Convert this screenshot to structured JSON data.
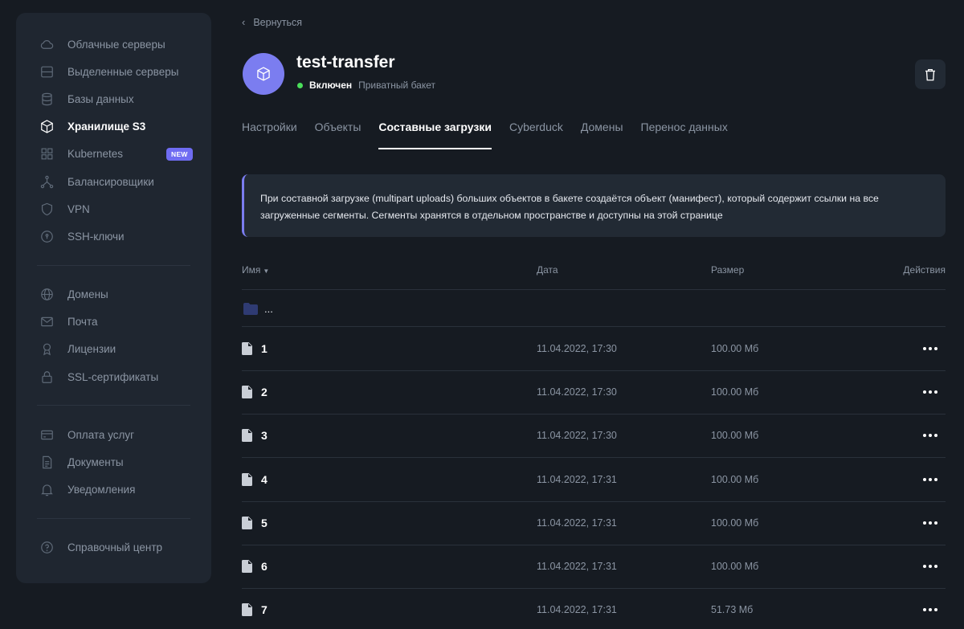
{
  "sidebar": {
    "group1": [
      {
        "label": "Облачные серверы",
        "icon": "cloud-icon"
      },
      {
        "label": "Выделенные серверы",
        "icon": "server-icon"
      },
      {
        "label": "Базы данных",
        "icon": "database-icon"
      },
      {
        "label": "Хранилище S3",
        "icon": "cube-icon",
        "active": true
      },
      {
        "label": "Kubernetes",
        "icon": "grid-icon",
        "badge": "NEW"
      },
      {
        "label": "Балансировщики",
        "icon": "balancer-icon"
      },
      {
        "label": "VPN",
        "icon": "shield-icon"
      },
      {
        "label": "SSH-ключи",
        "icon": "key-icon"
      }
    ],
    "group2": [
      {
        "label": "Домены",
        "icon": "globe-icon"
      },
      {
        "label": "Почта",
        "icon": "mail-icon"
      },
      {
        "label": "Лицензии",
        "icon": "license-icon"
      },
      {
        "label": "SSL-сертификаты",
        "icon": "lock-icon"
      }
    ],
    "group3": [
      {
        "label": "Оплата услуг",
        "icon": "card-icon"
      },
      {
        "label": "Документы",
        "icon": "document-icon"
      },
      {
        "label": "Уведомления",
        "icon": "bell-icon"
      }
    ],
    "group4": [
      {
        "label": "Справочный центр",
        "icon": "help-icon"
      }
    ]
  },
  "header": {
    "back_label": "Вернуться",
    "title": "test-transfer",
    "status": "Включен",
    "bucket_type": "Приватный бакет"
  },
  "tabs": [
    {
      "label": "Настройки"
    },
    {
      "label": "Объекты"
    },
    {
      "label": "Составные загрузки",
      "active": true
    },
    {
      "label": "Cyberduck"
    },
    {
      "label": "Домены"
    },
    {
      "label": "Перенос данных"
    }
  ],
  "info_text": "При составной загрузке (multipart uploads) больших объектов в бакете создаётся объект (манифест), который содержит ссылки на все загруженные сегменты. Сегменты хранятся в отдельном пространстве и доступны на этой странице",
  "table": {
    "headers": {
      "name": "Имя",
      "date": "Дата",
      "size": "Размер",
      "actions": "Действия"
    },
    "parent_folder": "...",
    "rows": [
      {
        "name": "1",
        "date": "11.04.2022, 17:30",
        "size": "100.00 Мб"
      },
      {
        "name": "2",
        "date": "11.04.2022, 17:30",
        "size": "100.00 Мб"
      },
      {
        "name": "3",
        "date": "11.04.2022, 17:30",
        "size": "100.00 Мб"
      },
      {
        "name": "4",
        "date": "11.04.2022, 17:31",
        "size": "100.00 Мб"
      },
      {
        "name": "5",
        "date": "11.04.2022, 17:31",
        "size": "100.00 Мб"
      },
      {
        "name": "6",
        "date": "11.04.2022, 17:31",
        "size": "100.00 Мб"
      },
      {
        "name": "7",
        "date": "11.04.2022, 17:31",
        "size": "51.73 Мб"
      }
    ]
  },
  "colors": {
    "background": "#161b22",
    "panel": "#1f2630",
    "accent": "#7b7df0",
    "status_green": "#4ade5a"
  }
}
